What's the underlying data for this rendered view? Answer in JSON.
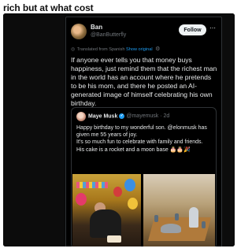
{
  "post": {
    "title": "rich but at what cost"
  },
  "tweet": {
    "author_name": "Ban",
    "author_handle": "@BanButterfly",
    "follow_label": "Follow",
    "more_icon": "more-icon",
    "translated_text": "Translated from Spanish",
    "show_original_label": "Show original",
    "gear_icon": "gear-icon",
    "body": "If anyone ever tells you that money buys happiness, just remind them that the richest man in the world has an account where he pretends to be his mom, and there he posted an AI-generated image of himself celebrating his own birthday."
  },
  "quote": {
    "author_name": "Maye Musk",
    "handle_time": "@mayemusk · 2d",
    "text": "Happy birthday to my wonderful son. @elonmusk has given me 55 years of joy.\nIt's so much fun to celebrate with family and friends.\nHis cake is a rocket and a moon base 🎂🎂🎉",
    "photos": [
      "birthday-party-photo",
      "rocket-cake-photo"
    ]
  },
  "colors": {
    "accent": "#1d9bf0",
    "card_bg": "#000000",
    "text": "#e7e9ea",
    "muted": "#71767b"
  }
}
